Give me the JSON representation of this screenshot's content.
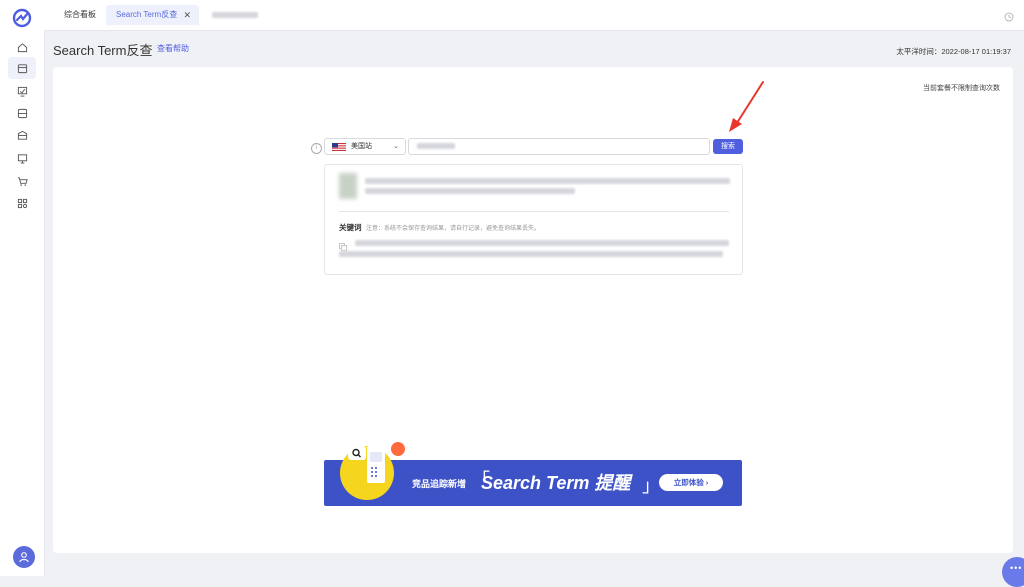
{
  "colors": {
    "accent": "#4f5fe0",
    "banner": "#3e52c8",
    "banner_circle": "#f5d51e"
  },
  "sidebar": {
    "logo_icon": "brand-logo-icon",
    "items": [
      {
        "icon": "home-icon"
      },
      {
        "icon": "box-icon",
        "active": true
      },
      {
        "icon": "chart-check-icon"
      },
      {
        "icon": "inbox-icon"
      },
      {
        "icon": "package-icon"
      },
      {
        "icon": "monitor-icon"
      },
      {
        "icon": "cart-icon"
      },
      {
        "icon": "apps-grid-icon"
      }
    ],
    "avatar_icon": "user-icon"
  },
  "tabs": [
    {
      "label": "综合看板"
    },
    {
      "label": "Search Term反查",
      "active": true,
      "close": "✕"
    }
  ],
  "header": {
    "title": "Search Term反查",
    "help": "查看帮助",
    "timezone": "太平洋时间：2022-08-17 01:19:37"
  },
  "panel": {
    "quota_note": "当前套餐不限制查询次数",
    "site_select": {
      "value": "美国站",
      "chevron": "⌄"
    },
    "search_button": "搜索",
    "result": {
      "keyword_label": "关键词",
      "keyword_note": "注意：系统不会保存查询结果，请自行记录，避免查询结果丢失。"
    },
    "banner": {
      "text1": "竞品追踪新增",
      "bracket_left": "「",
      "text2": "Search Term 提醒",
      "bracket_right": "」",
      "button": "立即体验 ›"
    }
  },
  "chat": {
    "dots": "•••"
  }
}
